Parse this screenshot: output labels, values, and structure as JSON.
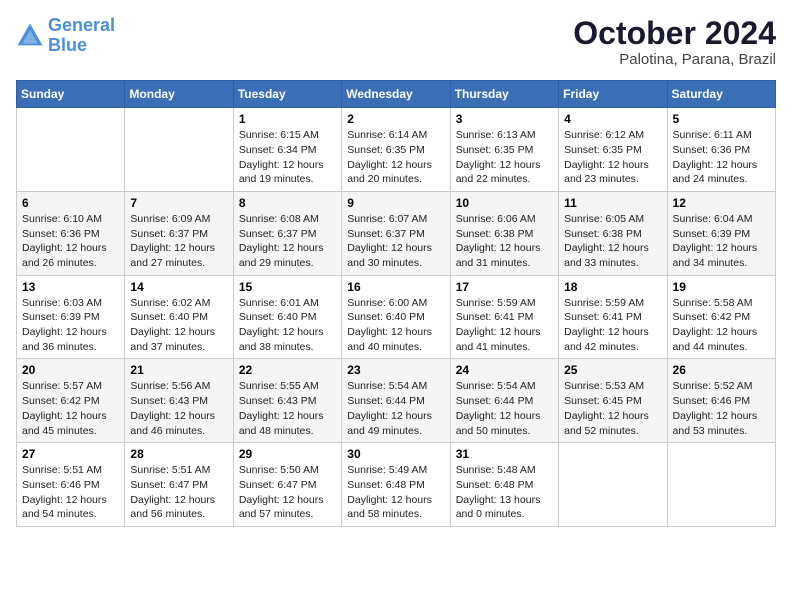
{
  "header": {
    "logo_general": "General",
    "logo_blue": "Blue",
    "month_title": "October 2024",
    "subtitle": "Palotina, Parana, Brazil"
  },
  "days_of_week": [
    "Sunday",
    "Monday",
    "Tuesday",
    "Wednesday",
    "Thursday",
    "Friday",
    "Saturday"
  ],
  "weeks": [
    [
      {
        "num": "",
        "sunrise": "",
        "sunset": "",
        "daylight": ""
      },
      {
        "num": "",
        "sunrise": "",
        "sunset": "",
        "daylight": ""
      },
      {
        "num": "1",
        "sunrise": "Sunrise: 6:15 AM",
        "sunset": "Sunset: 6:34 PM",
        "daylight": "Daylight: 12 hours and 19 minutes."
      },
      {
        "num": "2",
        "sunrise": "Sunrise: 6:14 AM",
        "sunset": "Sunset: 6:35 PM",
        "daylight": "Daylight: 12 hours and 20 minutes."
      },
      {
        "num": "3",
        "sunrise": "Sunrise: 6:13 AM",
        "sunset": "Sunset: 6:35 PM",
        "daylight": "Daylight: 12 hours and 22 minutes."
      },
      {
        "num": "4",
        "sunrise": "Sunrise: 6:12 AM",
        "sunset": "Sunset: 6:35 PM",
        "daylight": "Daylight: 12 hours and 23 minutes."
      },
      {
        "num": "5",
        "sunrise": "Sunrise: 6:11 AM",
        "sunset": "Sunset: 6:36 PM",
        "daylight": "Daylight: 12 hours and 24 minutes."
      }
    ],
    [
      {
        "num": "6",
        "sunrise": "Sunrise: 6:10 AM",
        "sunset": "Sunset: 6:36 PM",
        "daylight": "Daylight: 12 hours and 26 minutes."
      },
      {
        "num": "7",
        "sunrise": "Sunrise: 6:09 AM",
        "sunset": "Sunset: 6:37 PM",
        "daylight": "Daylight: 12 hours and 27 minutes."
      },
      {
        "num": "8",
        "sunrise": "Sunrise: 6:08 AM",
        "sunset": "Sunset: 6:37 PM",
        "daylight": "Daylight: 12 hours and 29 minutes."
      },
      {
        "num": "9",
        "sunrise": "Sunrise: 6:07 AM",
        "sunset": "Sunset: 6:37 PM",
        "daylight": "Daylight: 12 hours and 30 minutes."
      },
      {
        "num": "10",
        "sunrise": "Sunrise: 6:06 AM",
        "sunset": "Sunset: 6:38 PM",
        "daylight": "Daylight: 12 hours and 31 minutes."
      },
      {
        "num": "11",
        "sunrise": "Sunrise: 6:05 AM",
        "sunset": "Sunset: 6:38 PM",
        "daylight": "Daylight: 12 hours and 33 minutes."
      },
      {
        "num": "12",
        "sunrise": "Sunrise: 6:04 AM",
        "sunset": "Sunset: 6:39 PM",
        "daylight": "Daylight: 12 hours and 34 minutes."
      }
    ],
    [
      {
        "num": "13",
        "sunrise": "Sunrise: 6:03 AM",
        "sunset": "Sunset: 6:39 PM",
        "daylight": "Daylight: 12 hours and 36 minutes."
      },
      {
        "num": "14",
        "sunrise": "Sunrise: 6:02 AM",
        "sunset": "Sunset: 6:40 PM",
        "daylight": "Daylight: 12 hours and 37 minutes."
      },
      {
        "num": "15",
        "sunrise": "Sunrise: 6:01 AM",
        "sunset": "Sunset: 6:40 PM",
        "daylight": "Daylight: 12 hours and 38 minutes."
      },
      {
        "num": "16",
        "sunrise": "Sunrise: 6:00 AM",
        "sunset": "Sunset: 6:40 PM",
        "daylight": "Daylight: 12 hours and 40 minutes."
      },
      {
        "num": "17",
        "sunrise": "Sunrise: 5:59 AM",
        "sunset": "Sunset: 6:41 PM",
        "daylight": "Daylight: 12 hours and 41 minutes."
      },
      {
        "num": "18",
        "sunrise": "Sunrise: 5:59 AM",
        "sunset": "Sunset: 6:41 PM",
        "daylight": "Daylight: 12 hours and 42 minutes."
      },
      {
        "num": "19",
        "sunrise": "Sunrise: 5:58 AM",
        "sunset": "Sunset: 6:42 PM",
        "daylight": "Daylight: 12 hours and 44 minutes."
      }
    ],
    [
      {
        "num": "20",
        "sunrise": "Sunrise: 5:57 AM",
        "sunset": "Sunset: 6:42 PM",
        "daylight": "Daylight: 12 hours and 45 minutes."
      },
      {
        "num": "21",
        "sunrise": "Sunrise: 5:56 AM",
        "sunset": "Sunset: 6:43 PM",
        "daylight": "Daylight: 12 hours and 46 minutes."
      },
      {
        "num": "22",
        "sunrise": "Sunrise: 5:55 AM",
        "sunset": "Sunset: 6:43 PM",
        "daylight": "Daylight: 12 hours and 48 minutes."
      },
      {
        "num": "23",
        "sunrise": "Sunrise: 5:54 AM",
        "sunset": "Sunset: 6:44 PM",
        "daylight": "Daylight: 12 hours and 49 minutes."
      },
      {
        "num": "24",
        "sunrise": "Sunrise: 5:54 AM",
        "sunset": "Sunset: 6:44 PM",
        "daylight": "Daylight: 12 hours and 50 minutes."
      },
      {
        "num": "25",
        "sunrise": "Sunrise: 5:53 AM",
        "sunset": "Sunset: 6:45 PM",
        "daylight": "Daylight: 12 hours and 52 minutes."
      },
      {
        "num": "26",
        "sunrise": "Sunrise: 5:52 AM",
        "sunset": "Sunset: 6:46 PM",
        "daylight": "Daylight: 12 hours and 53 minutes."
      }
    ],
    [
      {
        "num": "27",
        "sunrise": "Sunrise: 5:51 AM",
        "sunset": "Sunset: 6:46 PM",
        "daylight": "Daylight: 12 hours and 54 minutes."
      },
      {
        "num": "28",
        "sunrise": "Sunrise: 5:51 AM",
        "sunset": "Sunset: 6:47 PM",
        "daylight": "Daylight: 12 hours and 56 minutes."
      },
      {
        "num": "29",
        "sunrise": "Sunrise: 5:50 AM",
        "sunset": "Sunset: 6:47 PM",
        "daylight": "Daylight: 12 hours and 57 minutes."
      },
      {
        "num": "30",
        "sunrise": "Sunrise: 5:49 AM",
        "sunset": "Sunset: 6:48 PM",
        "daylight": "Daylight: 12 hours and 58 minutes."
      },
      {
        "num": "31",
        "sunrise": "Sunrise: 5:48 AM",
        "sunset": "Sunset: 6:48 PM",
        "daylight": "Daylight: 13 hours and 0 minutes."
      },
      {
        "num": "",
        "sunrise": "",
        "sunset": "",
        "daylight": ""
      },
      {
        "num": "",
        "sunrise": "",
        "sunset": "",
        "daylight": ""
      }
    ]
  ]
}
